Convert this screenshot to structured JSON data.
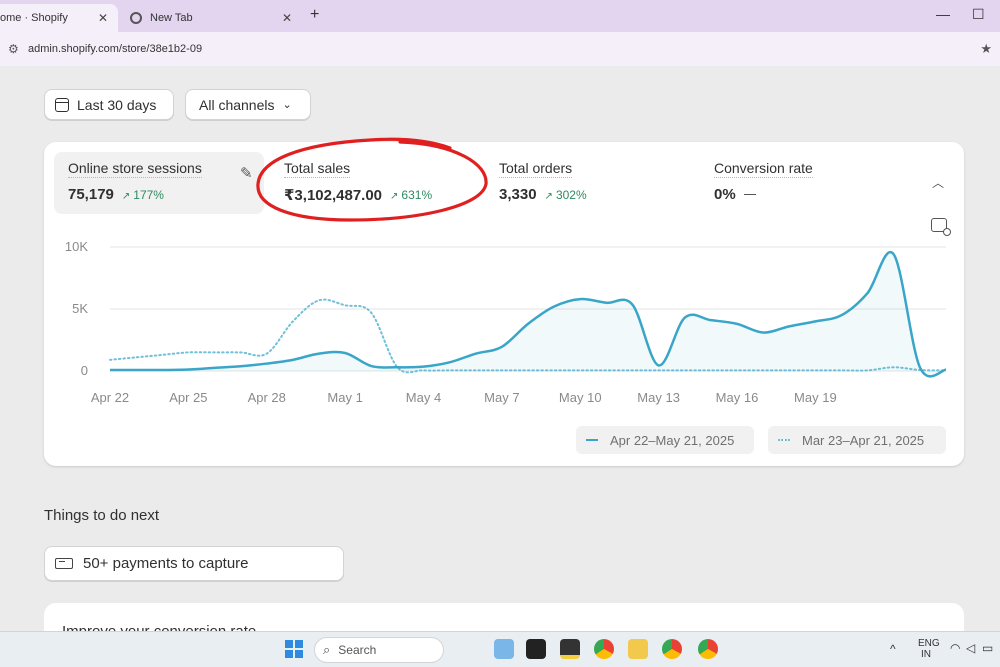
{
  "browser": {
    "tabs": [
      {
        "title": "ome · Shopify",
        "close": "✕",
        "active": true
      },
      {
        "title": "New Tab",
        "close": "✕",
        "active": false
      }
    ],
    "new_tab": "+",
    "window_controls": {
      "minimize": "—",
      "maximize": "☐"
    },
    "url": "admin.shopify.com/store/38e1b2-09",
    "icons": [
      "site-info-icon",
      "bookmark-star-icon",
      "chrome-icon"
    ]
  },
  "filters": {
    "date_range": "Last 30 days",
    "channels": "All channels",
    "channels_chevron": "⌄"
  },
  "metrics": [
    {
      "label": "Online store sessions",
      "value": "75,179",
      "change": "177%",
      "selected": true
    },
    {
      "label": "Total sales",
      "value": "₹3,102,487.00",
      "change": "631%",
      "selected": false
    },
    {
      "label": "Total orders",
      "value": "3,330",
      "change": "302%",
      "selected": false
    },
    {
      "label": "Conversion rate",
      "value": "0%",
      "change": "",
      "selected": false
    }
  ],
  "chart_data": {
    "type": "line",
    "y_ticks": [
      "10K",
      "5K",
      "0"
    ],
    "ylim": [
      0,
      10000
    ],
    "x_ticks": [
      "Apr 22",
      "Apr 25",
      "Apr 28",
      "May 1",
      "May 4",
      "May 7",
      "May 10",
      "May 13",
      "May 16",
      "May 19"
    ],
    "grid": true,
    "series": [
      {
        "name": "Apr 22–May 21, 2025",
        "style": "solid",
        "color": "#39a5c8",
        "values": [
          80,
          80,
          80,
          120,
          250,
          380,
          600,
          900,
          1400,
          1450,
          400,
          300,
          350,
          700,
          1400,
          1950,
          3800,
          5200,
          5800,
          5500,
          5350,
          450,
          4300,
          4100,
          3800,
          3100,
          3600,
          4000,
          4500,
          6300,
          9400,
          300,
          100
        ]
      },
      {
        "name": "Mar 23–Apr 21, 2025",
        "style": "dotted",
        "color": "#6fc0d8",
        "values": [
          900,
          1100,
          1300,
          1500,
          1500,
          1500,
          1400,
          4000,
          5700,
          5300,
          4700,
          300,
          50,
          50,
          50,
          50,
          50,
          50,
          50,
          50,
          50,
          50,
          50,
          50,
          50,
          50,
          50,
          50,
          50,
          50,
          300,
          80,
          50
        ]
      }
    ]
  },
  "legend": [
    {
      "label": "Apr 22–May 21, 2025"
    },
    {
      "label": "Mar 23–Apr 21, 2025"
    }
  ],
  "annotation_color": "#e02020",
  "things_to_do": {
    "title": "Things to do next",
    "task": "50+ payments to capture",
    "next_card": "Improve your conversion rate"
  },
  "taskbar": {
    "search_placeholder": "Search",
    "language_top": "ENG",
    "language_bottom": "IN",
    "tray_chevron": "^"
  }
}
